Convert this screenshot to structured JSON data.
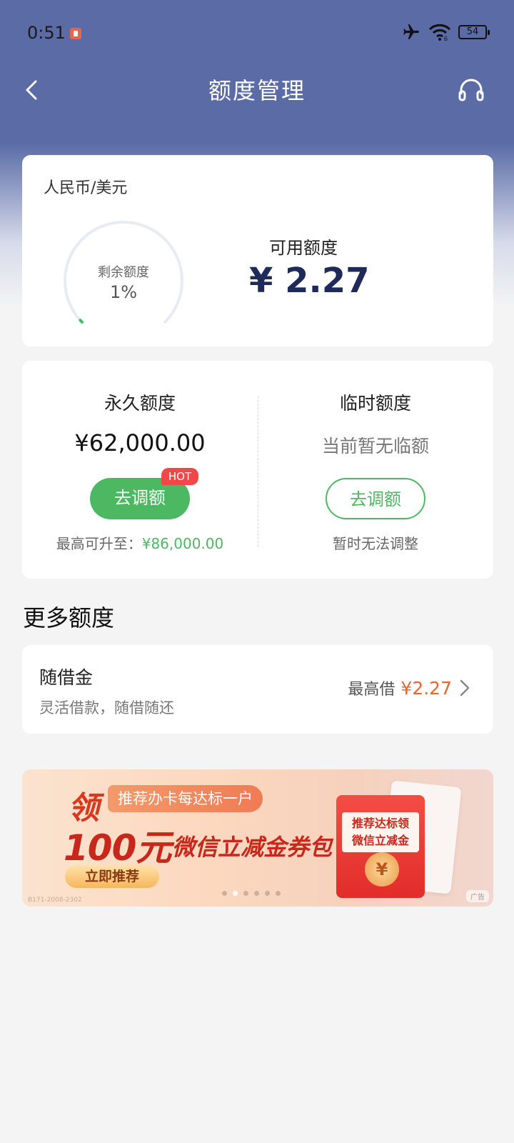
{
  "status_bar": {
    "time": "0:51",
    "battery": "54",
    "icons": [
      "record-icon",
      "airplane-icon",
      "wifi-icon",
      "battery-icon"
    ]
  },
  "nav": {
    "title": "额度管理",
    "back_icon": "chevron-left-icon",
    "service_icon": "headset-icon"
  },
  "quota_card": {
    "currency": "人民币/美元",
    "gauge_label": "剩余额度",
    "gauge_value": "1%",
    "gauge_percent": 1,
    "available_label": "可用额度",
    "available_value": "¥ 2.27"
  },
  "limits": {
    "permanent": {
      "title": "永久额度",
      "amount": "¥62,000.00",
      "button": "去调额",
      "hot_badge": "HOT",
      "note_prefix": "最高可升至：",
      "note_value": "¥86,000.00"
    },
    "temporary": {
      "title": "临时额度",
      "status": "当前暂无临额",
      "button": "去调额",
      "note": "暂时无法调整"
    }
  },
  "more": {
    "section_title": "更多额度",
    "item": {
      "title": "随借金",
      "subtitle": "灵活借款，随借随还",
      "max_label": "最高借",
      "max_value": "¥2.27"
    }
  },
  "banner": {
    "ling": "领",
    "pill": "推荐办卡每达标一户",
    "big": "100元",
    "sub": "微信立减金券包",
    "button": "立即推荐",
    "envelope_text_1": "推荐达标领",
    "envelope_text_2": "微信立减金",
    "coin": "¥",
    "ad_tag": "广告",
    "code": "B171-2008-2302",
    "dots_total": 6,
    "dot_active": 1
  },
  "colors": {
    "header_bg": "#5a6ba6",
    "green": "#4cb962",
    "orange": "#e8642c",
    "hot_red": "#f04848",
    "navy_text": "#1e2a5a"
  }
}
